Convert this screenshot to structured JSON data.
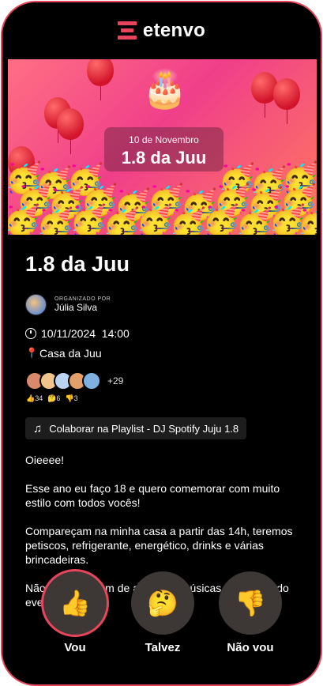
{
  "app": {
    "brand": "etenvo"
  },
  "banner": {
    "date_label": "10 de Novembro",
    "event_title": "1.8 da Juu"
  },
  "event": {
    "title": "1.8 da Juu",
    "organizer_label": "ORGANIZADO POR",
    "organizer_name": "Júlia Silva",
    "datetime": "10/11/2024  14:00",
    "location": "Casa da Juu",
    "attendees_more": "+29",
    "counts": {
      "yes": "👍34",
      "maybe": "🤔6",
      "no": "👎3"
    },
    "playlist": "Colaborar na Playlist - DJ Spotify Juju 1.8",
    "description": "Oieeee!\n\nEsse ano eu faço 18 e quero comemorar com muito estilo com todos vocês!\n\nCompareçam na minha casa a partir das 14h, teremos petiscos, refrigerante, energético, drinks e várias brincadeiras.\n\nNão se esqueçam de adicionar músicas na playlist do evento!"
  },
  "actions": [
    {
      "label": "Vou",
      "icon": "👍",
      "selected": true
    },
    {
      "label": "Talvez",
      "icon": "🤔",
      "selected": false
    },
    {
      "label": "Não vou",
      "icon": "👎",
      "selected": false
    }
  ],
  "colors": {
    "accent": "#e8455d",
    "background": "#000000"
  }
}
